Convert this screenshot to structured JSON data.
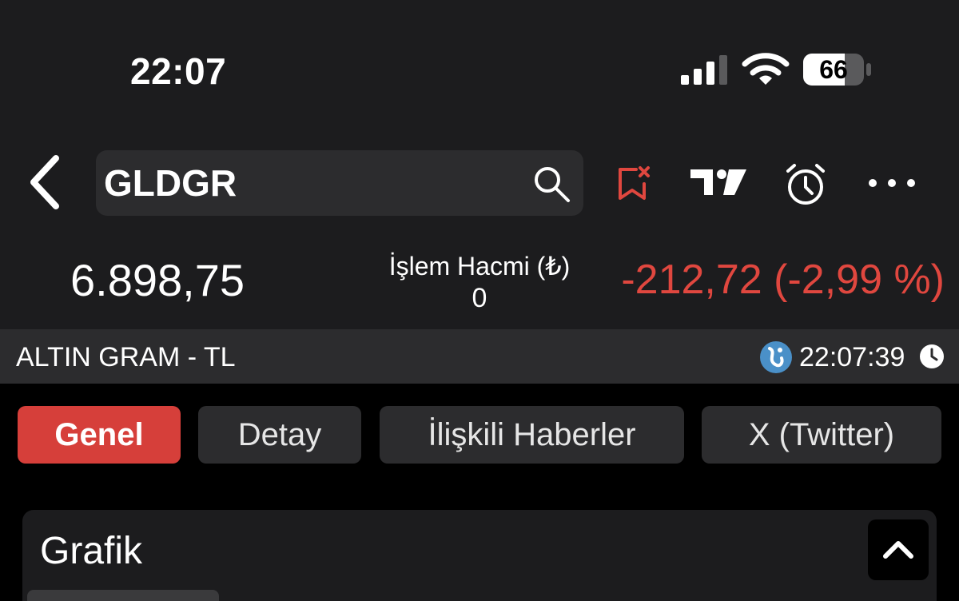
{
  "status_bar": {
    "time": "22:07",
    "battery_level": "66",
    "icons": [
      "signal-icon",
      "wifi-icon",
      "battery-icon"
    ]
  },
  "header": {
    "search_value": "GLDGR",
    "icons": [
      "back-icon",
      "search-icon",
      "bookmark-remove-icon",
      "tradingview-icon",
      "alarm-icon",
      "more-icon"
    ]
  },
  "quote": {
    "price": "6.898,75",
    "volume_label": "İşlem Hacmi (₺)",
    "volume_value": "0",
    "change": "-212,72 (-2,99 %)"
  },
  "info_bar": {
    "instrument_name": "ALTIN GRAM - TL",
    "update_time": "22:07:39"
  },
  "tabs": [
    {
      "label": "Genel",
      "active": true
    },
    {
      "label": "Detay",
      "active": false
    },
    {
      "label": "İlişkili Haberler",
      "active": false
    },
    {
      "label": "X (Twitter)",
      "active": false
    }
  ],
  "chart_card": {
    "title": "Grafik"
  },
  "colors": {
    "background": "#1c1c1e",
    "panel": "#2c2c2e",
    "negative": "#e0473f",
    "active_tab": "#d63f3a",
    "bookmark_icon": "#e0473f"
  }
}
